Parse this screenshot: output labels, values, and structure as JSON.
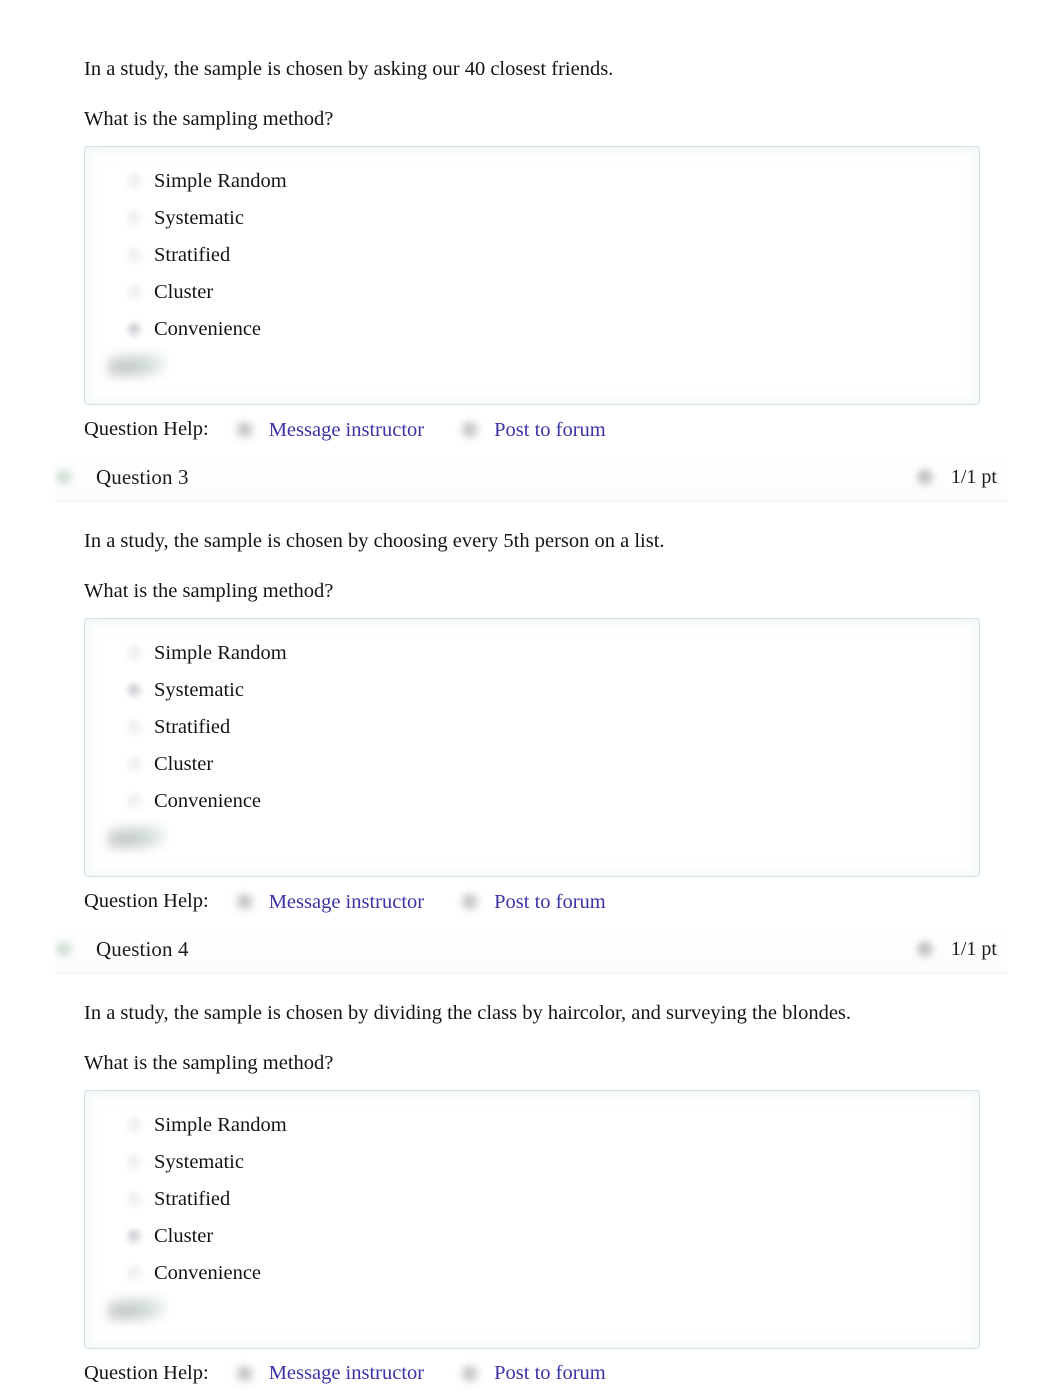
{
  "page": {
    "background": "#ffffff",
    "link_color": "#3a33a6",
    "answer_box_border": "#b0d0b8",
    "text_color": "#141414"
  },
  "help_row": {
    "label": "Question Help:",
    "items": [
      {
        "icon": "envelope-icon",
        "label": "Message instructor"
      },
      {
        "icon": "forum-icon",
        "label": "Post to forum"
      }
    ]
  },
  "questions": [
    {
      "header": null,
      "status_icon": "check-circle-icon",
      "prompt": "In a study, the sample is chosen by asking our 40 closest friends.",
      "subprompt": "What is the sampling method?",
      "options": [
        {
          "label": "Simple Random",
          "selected": false
        },
        {
          "label": "Systematic",
          "selected": false
        },
        {
          "label": "Stratified",
          "selected": false
        },
        {
          "label": "Cluster",
          "selected": false
        },
        {
          "label": "Convenience",
          "selected": true
        }
      ],
      "result_marker": "correct-check-icon"
    },
    {
      "header": {
        "title": "Question 3",
        "points": "1/1 pt",
        "status_icon": "check-circle-icon",
        "points_icon": "score-circle-icon"
      },
      "prompt": "In a study, the sample is chosen by choosing every 5th person on a list.",
      "subprompt": "What is the sampling method?",
      "options": [
        {
          "label": "Simple Random",
          "selected": false
        },
        {
          "label": "Systematic",
          "selected": true
        },
        {
          "label": "Stratified",
          "selected": false
        },
        {
          "label": "Cluster",
          "selected": false
        },
        {
          "label": "Convenience",
          "selected": false
        }
      ],
      "result_marker": "correct-check-icon"
    },
    {
      "header": {
        "title": "Question 4",
        "points": "1/1 pt",
        "status_icon": "check-circle-icon",
        "points_icon": "score-circle-icon"
      },
      "prompt": "In a study, the sample is chosen by dividing the class by haircolor, and surveying the blondes.",
      "subprompt": "What is the sampling method?",
      "options": [
        {
          "label": "Simple Random",
          "selected": false
        },
        {
          "label": "Systematic",
          "selected": false
        },
        {
          "label": "Stratified",
          "selected": false
        },
        {
          "label": "Cluster",
          "selected": true
        },
        {
          "label": "Convenience",
          "selected": false
        }
      ],
      "result_marker": "correct-check-icon"
    }
  ]
}
